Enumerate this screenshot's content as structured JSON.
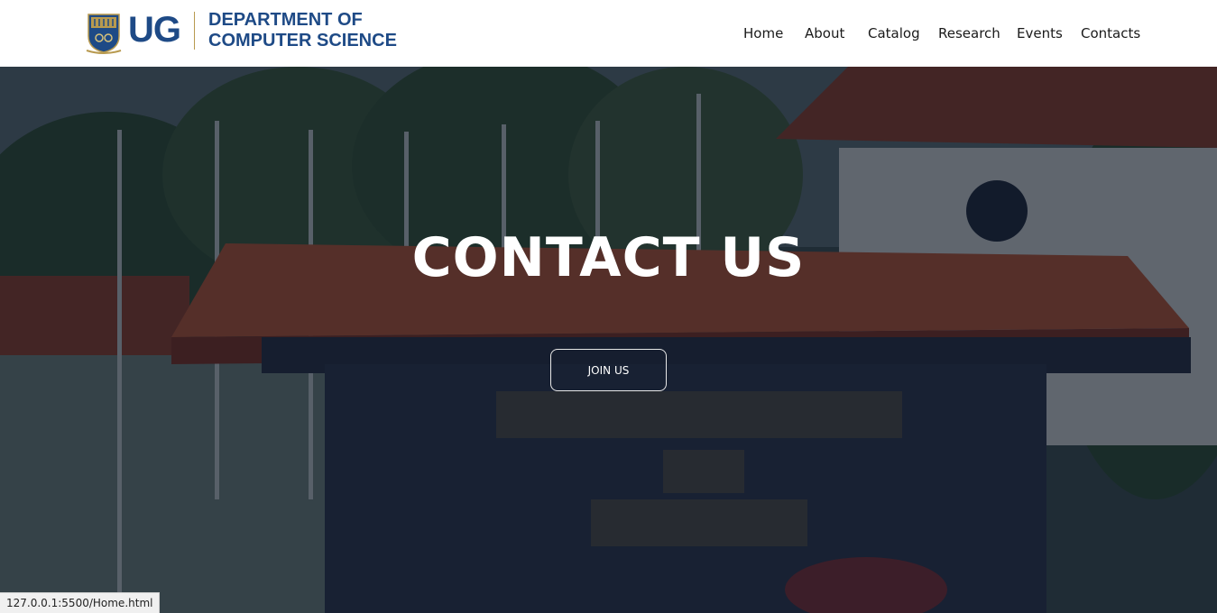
{
  "header": {
    "logo": {
      "short": "UG",
      "line1": "DEPARTMENT OF",
      "line2": "COMPUTER SCIENCE"
    },
    "nav": [
      {
        "label": "Home"
      },
      {
        "label": "About"
      },
      {
        "label": "Catalog"
      },
      {
        "label": "Research"
      },
      {
        "label": "Events"
      },
      {
        "label": "Contacts"
      }
    ]
  },
  "hero": {
    "title": "CONTACT US",
    "button_label": "JOIN US"
  },
  "status_bar": {
    "url": "127.0.0.1:5500/Home.html"
  },
  "colors": {
    "brand_blue": "#1e4a86",
    "gold": "#b89a4f",
    "overlay": "#0a1428"
  }
}
